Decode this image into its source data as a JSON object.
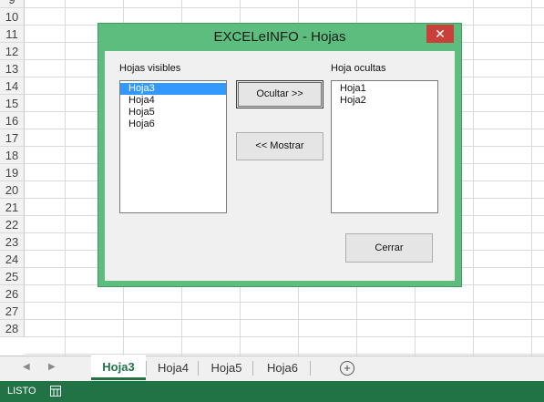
{
  "sheet": {
    "row_numbers": [
      "9",
      "10",
      "11",
      "12",
      "13",
      "14",
      "15",
      "16",
      "17",
      "18",
      "19",
      "20",
      "21",
      "22",
      "23",
      "24",
      "25",
      "26",
      "27",
      "28"
    ]
  },
  "dialog": {
    "title": "EXCELeINFO - Hojas",
    "close_label": "✕",
    "visible_label": "Hojas visibles",
    "hidden_label": "Hoja ocultas",
    "visible_sheets": [
      "Hoja3",
      "Hoja4",
      "Hoja5",
      "Hoja6"
    ],
    "visible_selected": "Hoja3",
    "hidden_sheets": [
      "Hoja1",
      "Hoja2"
    ],
    "hide_button": "Ocultar >>",
    "show_button": "<< Mostrar",
    "close_button": "Cerrar"
  },
  "tabs": {
    "items": [
      "Hoja3",
      "Hoja4",
      "Hoja5",
      "Hoja6"
    ],
    "active": "Hoja3",
    "add_label": "+"
  },
  "status": {
    "text": "LISTO"
  },
  "colors": {
    "accent": "#217346",
    "dialog_frame": "#5dbd7f",
    "close_red": "#c9403a",
    "selection": "#3399ff"
  }
}
